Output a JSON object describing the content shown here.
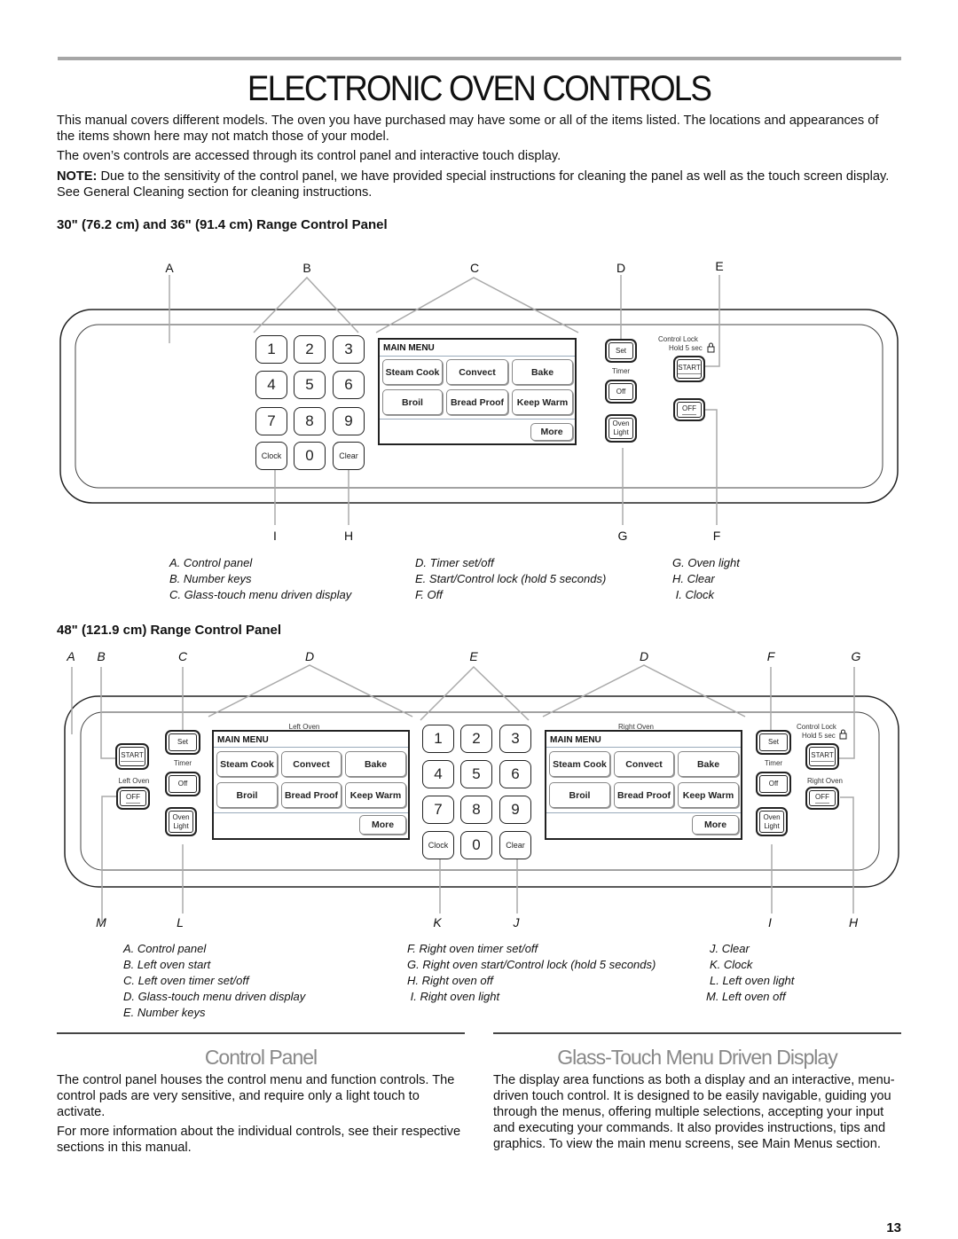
{
  "page": {
    "title": "ELECTRONIC OVEN CONTROLS",
    "intro": [
      "This manual covers different models. The oven you have purchased may have some or all of the items listed. The locations and appearances of the items shown here may not match those of your model.",
      "The oven’s controls are accessed through its control panel and interactive touch display."
    ],
    "note_label": "NOTE:",
    "note_text": " Due to the sensitivity of the control panel, we have provided special instructions for cleaning the panel as well as the touch screen display. See  General Cleaning  section for cleaning instructions.",
    "page_number": "13"
  },
  "panel30": {
    "heading": "30\" (76.2 cm) and 36\" (91.4 cm) Range Control Panel",
    "top_labels": [
      "A",
      "B",
      "C",
      "D",
      "E"
    ],
    "bottom_labels": [
      "I",
      "H",
      "G",
      "F"
    ],
    "keys": [
      "1",
      "2",
      "3",
      "4",
      "5",
      "6",
      "7",
      "8",
      "9",
      "Clock",
      "0",
      "Clear"
    ],
    "menu": {
      "header": "MAIN MENU",
      "buttons": [
        "Steam Cook",
        "Convect",
        "Bake",
        "Broil",
        "Bread Proof",
        "Keep Warm"
      ],
      "more": "More"
    },
    "set": "Set",
    "timer": "Timer",
    "off_small": "Off",
    "oven_light": [
      "Oven",
      "Light"
    ],
    "control_lock": [
      "Control Lock",
      "Hold 5 sec"
    ],
    "start": "START",
    "off": "OFF",
    "legend": [
      [
        "A. Control panel",
        "B. Number keys",
        "C. Glass-touch menu driven display"
      ],
      [
        "D. Timer set/off",
        "E. Start/Control lock (hold 5 seconds)",
        "F. Off"
      ],
      [
        "G. Oven light",
        "H. Clear",
        " I. Clock"
      ]
    ]
  },
  "panel48": {
    "heading": "48\" (121.9 cm) Range Control Panel",
    "top_labels": [
      "A",
      "B",
      "C",
      "D",
      "E",
      "D",
      "F",
      "G"
    ],
    "bottom_labels": [
      "M",
      "L",
      "K",
      "J",
      "I",
      "H"
    ],
    "left_oven_title": "Left Oven",
    "right_oven_title": "Right Oven",
    "keys": [
      "1",
      "2",
      "3",
      "4",
      "5",
      "6",
      "7",
      "8",
      "9",
      "Clock",
      "0",
      "Clear"
    ],
    "menu": {
      "header": "MAIN MENU",
      "buttons": [
        "Steam Cook",
        "Convect",
        "Bake",
        "Broil",
        "Bread Proof",
        "Keep Warm"
      ],
      "more": "More"
    },
    "set": "Set",
    "timer": "Timer",
    "off_small": "Off",
    "oven_light": [
      "Oven",
      "Light"
    ],
    "control_lock": [
      "Control Lock",
      "Hold 5 sec"
    ],
    "start": "START",
    "off": "OFF",
    "left_oven_label": "Left Oven",
    "right_oven_label": "Right Oven",
    "legend": [
      [
        "A. Control panel",
        "B. Left oven start",
        "C. Left oven timer set/off",
        "D. Glass-touch menu driven display",
        "E. Number keys"
      ],
      [
        "F. Right oven timer set/off",
        "G. Right oven start/Control lock (hold 5 seconds)",
        "H. Right oven off",
        " I. Right oven light"
      ],
      [
        "J. Clear",
        "K. Clock",
        "L. Left oven light",
        "M. Left oven off"
      ]
    ]
  },
  "sections": {
    "control_panel": {
      "title": "Control Panel",
      "paragraphs": [
        "The control panel houses the control menu and function controls. The control pads are very sensitive, and require only a light touch to activate.",
        "For more information about the individual controls, see their respective sections in this manual."
      ]
    },
    "glass_touch": {
      "title": "Glass-Touch Menu Driven Display",
      "paragraphs": [
        "The display area functions as both a display and an interactive, menu-driven touch control. It is designed to be easily navigable, guiding you through the menus, offering multiple selections, accepting your input and executing your commands. It also provides instructions, tips and graphics. To view the main menu screens, see  Main Menus  section."
      ]
    }
  }
}
